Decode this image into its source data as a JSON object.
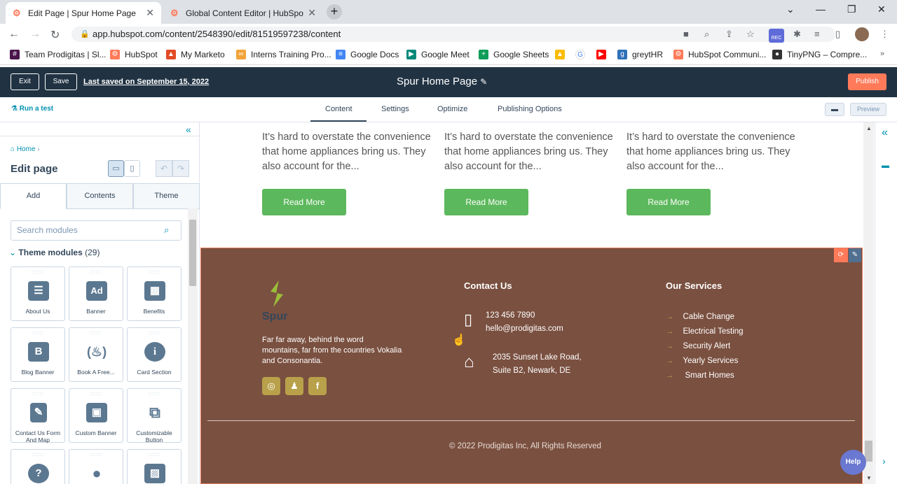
{
  "browser": {
    "tabs": [
      {
        "title": "Edit Page | Spur Home Page",
        "active": true
      },
      {
        "title": "Global Content Editor | HubSpot",
        "active": false
      }
    ],
    "url": "app.hubspot.com/content/2548390/edit/81519597238/content",
    "rec_label": "REC",
    "bookmarks": [
      "Team Prodigitas | Sl...",
      "HubSpot",
      "My Marketo",
      "Interns Training Pro...",
      "Google Docs",
      "Google Meet",
      "Google Sheets",
      "greytHR",
      "HubSpot Communi...",
      "TinyPNG – Compre..."
    ]
  },
  "header": {
    "exit": "Exit",
    "save": "Save",
    "last_saved": "Last saved on September 15, 2022",
    "page_title": "Spur Home Page",
    "publish": "Publish"
  },
  "toolbar": {
    "run_test": "Run a test",
    "tabs": [
      "Content",
      "Settings",
      "Optimize",
      "Publishing Options"
    ],
    "active_tab": "Content",
    "preview": "Preview"
  },
  "left_panel": {
    "breadcrumb": "Home",
    "title": "Edit page",
    "tabs": [
      "Add",
      "Contents",
      "Theme"
    ],
    "search_placeholder": "Search modules",
    "section_label": "Theme modules",
    "section_count": "(29)",
    "modules": [
      {
        "label": "About Us",
        "icon": "contact-book-icon"
      },
      {
        "label": "Banner",
        "icon": "ad-icon"
      },
      {
        "label": "Benefits",
        "icon": "building-icon"
      },
      {
        "label": "Blog Banner",
        "icon": "blog-icon"
      },
      {
        "label": "Book A Free...",
        "icon": "fire-icon"
      },
      {
        "label": "Card Section",
        "icon": "info-icon"
      },
      {
        "label": "Contact Us Form And Map",
        "icon": "form-icon"
      },
      {
        "label": "Custom Banner",
        "icon": "image-gallery-icon"
      },
      {
        "label": "Customizable Button",
        "icon": "external-link-icon"
      },
      {
        "label": "",
        "icon": "question-icon"
      },
      {
        "label": "",
        "icon": "person-icon"
      },
      {
        "label": "",
        "icon": "image-icon"
      }
    ]
  },
  "canvas": {
    "cards": [
      {
        "text": "It’s hard to overstate the convenience that home appliances bring us. They also account for the...",
        "button": "Read More"
      },
      {
        "text": "It’s hard to overstate the convenience that home appliances bring us. They also account for the...",
        "button": "Read More"
      },
      {
        "text": "It’s hard to overstate the convenience that home appliances bring us. They also account for the...",
        "button": "Read More"
      }
    ],
    "footer": {
      "brand": "Spur",
      "description": "Far far away, behind the word mountains, far from the countries Vokalia and Consonantia.",
      "social": [
        "instagram-icon",
        "snapchat-icon",
        "facebook-icon"
      ],
      "contact_heading": "Contact Us",
      "phone": "123 456 7890",
      "email": "hello@prodigitas.com",
      "address_line1": "2035 Sunset Lake Road,",
      "address_line2": "Suite B2, Newark, DE",
      "services_heading": "Our Services",
      "services": [
        "Cable Change",
        "Electrical Testing",
        "Security Alert",
        "Yearly Services",
        "Smart Homes"
      ],
      "copyright": "© 2022 Prodigitas Inc, All Rights Reserved"
    }
  },
  "help": "Help",
  "colors": {
    "hs_header": "#213343",
    "publish": "#ff7a59",
    "read_more": "#5cb85c",
    "footer_bg": "#7a5040",
    "accent_gold": "#b8a14a",
    "help": "#6a78d1"
  }
}
